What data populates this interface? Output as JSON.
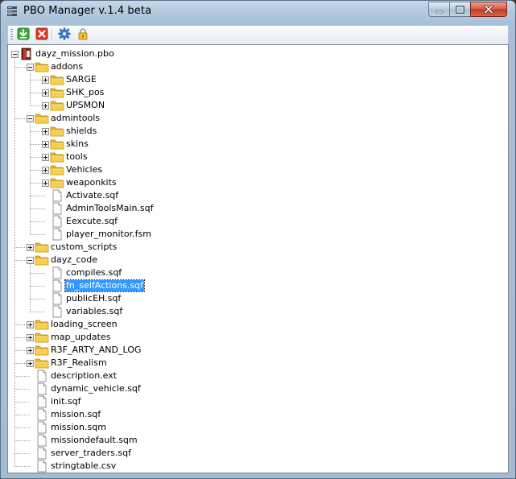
{
  "window": {
    "title": "PBO Manager v.1.4 beta"
  },
  "toolbar": {
    "buttons": [
      {
        "icon": "download-icon"
      },
      {
        "icon": "delete-icon"
      },
      {
        "icon": "gear-icon"
      },
      {
        "icon": "lock-icon"
      }
    ]
  },
  "tree": {
    "root": "dayz_mission.pbo",
    "items": [
      {
        "label": "addons",
        "type": "folder",
        "depth": 1,
        "expanded": true
      },
      {
        "label": "SARGE",
        "type": "folder",
        "depth": 2,
        "expanded": false
      },
      {
        "label": "SHK_pos",
        "type": "folder",
        "depth": 2,
        "expanded": false
      },
      {
        "label": "UPSMON",
        "type": "folder",
        "depth": 2,
        "expanded": false
      },
      {
        "label": "admintools",
        "type": "folder",
        "depth": 1,
        "expanded": true
      },
      {
        "label": "shields",
        "type": "folder",
        "depth": 2,
        "expanded": false
      },
      {
        "label": "skins",
        "type": "folder",
        "depth": 2,
        "expanded": false
      },
      {
        "label": "tools",
        "type": "folder",
        "depth": 2,
        "expanded": false
      },
      {
        "label": "Vehicles",
        "type": "folder",
        "depth": 2,
        "expanded": false
      },
      {
        "label": "weaponkits",
        "type": "folder",
        "depth": 2,
        "expanded": false
      },
      {
        "label": "Activate.sqf",
        "type": "file",
        "depth": 2
      },
      {
        "label": "AdminToolsMain.sqf",
        "type": "file",
        "depth": 2
      },
      {
        "label": "Eexcute.sqf",
        "type": "file",
        "depth": 2
      },
      {
        "label": "player_monitor.fsm",
        "type": "file",
        "depth": 2
      },
      {
        "label": "custom_scripts",
        "type": "folder",
        "depth": 1,
        "expanded": false
      },
      {
        "label": "dayz_code",
        "type": "folder",
        "depth": 1,
        "expanded": true
      },
      {
        "label": "compiles.sqf",
        "type": "file",
        "depth": 2
      },
      {
        "label": "fn_selfActions.sqf",
        "type": "file",
        "depth": 2,
        "selected": true
      },
      {
        "label": "publicEH.sqf",
        "type": "file",
        "depth": 2
      },
      {
        "label": "variables.sqf",
        "type": "file",
        "depth": 2
      },
      {
        "label": "loading_screen",
        "type": "folder",
        "depth": 1,
        "expanded": false
      },
      {
        "label": "map_updates",
        "type": "folder",
        "depth": 1,
        "expanded": false
      },
      {
        "label": "R3F_ARTY_AND_LOG",
        "type": "folder",
        "depth": 1,
        "expanded": false
      },
      {
        "label": "R3F_Realism",
        "type": "folder",
        "depth": 1,
        "expanded": false
      },
      {
        "label": "description.ext",
        "type": "file",
        "depth": 1
      },
      {
        "label": "dynamic_vehicle.sqf",
        "type": "file",
        "depth": 1
      },
      {
        "label": "init.sqf",
        "type": "file",
        "depth": 1
      },
      {
        "label": "mission.sqf",
        "type": "file",
        "depth": 1
      },
      {
        "label": "mission.sqm",
        "type": "file",
        "depth": 1
      },
      {
        "label": "missiondefault.sqm",
        "type": "file",
        "depth": 1
      },
      {
        "label": "server_traders.sqf",
        "type": "file",
        "depth": 1
      },
      {
        "label": "stringtable.csv",
        "type": "file",
        "depth": 1
      }
    ]
  },
  "colors": {
    "selection": "#3399ff",
    "folder": "#f5c544",
    "close_button": "#c8432b"
  }
}
